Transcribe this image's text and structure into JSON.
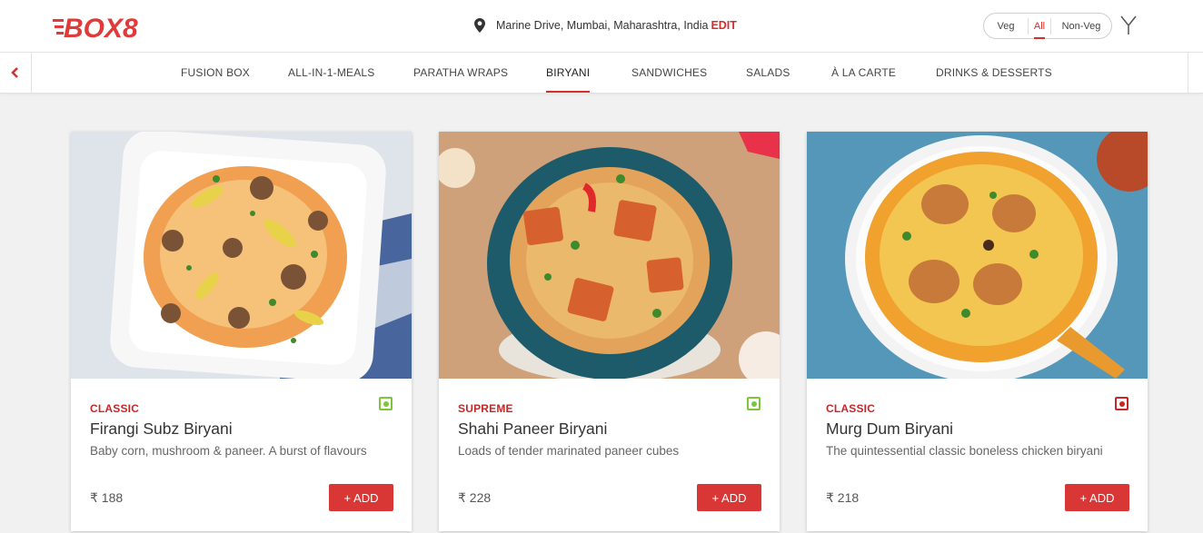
{
  "brand": {
    "logo_text": "BOX8",
    "color": "#e03a3a"
  },
  "location": {
    "address": "Marine Drive, Mumbai, Maharashtra, India",
    "edit_label": "EDIT",
    "icon": "map-pin-icon"
  },
  "diet_filter": {
    "options": [
      "Veg",
      "All",
      "Non-Veg"
    ],
    "selected": "All"
  },
  "filter_icon": "filter-icon",
  "nav": {
    "items": [
      "FUSION BOX",
      "ALL-IN-1-MEALS",
      "PARATHA WRAPS",
      "BIRYANI",
      "SANDWICHES",
      "SALADS",
      "À LA CARTE",
      "DRINKS & DESSERTS"
    ],
    "active": "BIRYANI"
  },
  "colors": {
    "accent": "#d32f2f",
    "veg": "#7cc63c",
    "nonveg": "#c62828"
  },
  "products": [
    {
      "tier": "CLASSIC",
      "name": "Firangi Subz Biryani",
      "desc": "Baby corn, mushroom & paneer. A burst of flavours",
      "price": "₹ 188",
      "add_label": "+ ADD",
      "diet": "veg"
    },
    {
      "tier": "SUPREME",
      "name": "Shahi Paneer Biryani",
      "desc": "Loads of tender marinated paneer cubes",
      "price": "₹ 228",
      "add_label": "+ ADD",
      "diet": "veg"
    },
    {
      "tier": "CLASSIC",
      "name": "Murg Dum Biryani",
      "desc": "The quintessential classic boneless chicken biryani",
      "price": "₹ 218",
      "add_label": "+ ADD",
      "diet": "nonveg"
    }
  ]
}
